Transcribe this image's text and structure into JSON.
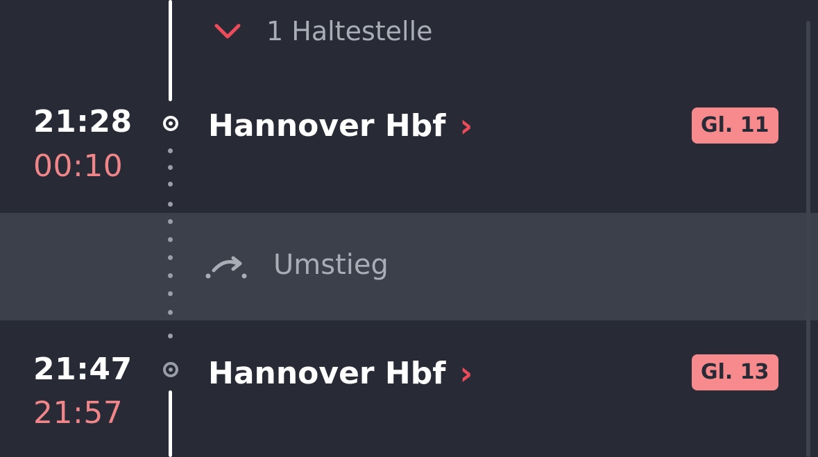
{
  "stops_toggle": {
    "label": "1 Haltestelle",
    "icon": "chevron-down-icon",
    "accent": "#ec4b59"
  },
  "stops": [
    {
      "time": "21:28",
      "realtime": "00:10",
      "station": "Hannover Hbf",
      "chevron": "›",
      "platform": "Gl. 11"
    },
    {
      "time": "21:47",
      "realtime": "21:57",
      "station": "Hannover Hbf",
      "chevron": "›",
      "platform": "Gl. 13"
    }
  ],
  "transfer": {
    "label": "Umstieg",
    "icon": "transfer-arrow-icon"
  },
  "colors": {
    "background": "#282b35",
    "transfer_band": "#3b404b",
    "delay": "#f0868a",
    "platform_badge": "#f68a8d",
    "chevron": "#ec4b59"
  }
}
